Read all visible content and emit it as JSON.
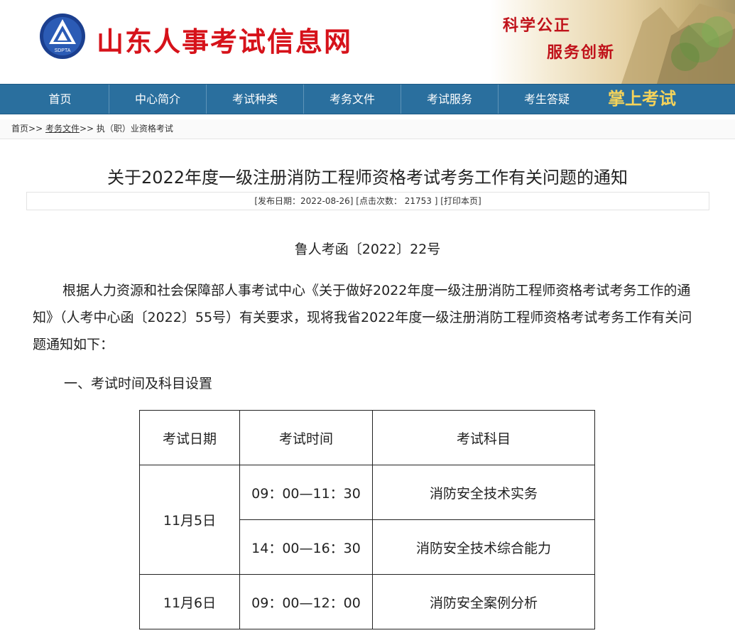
{
  "header": {
    "logo_text": "SDPTA",
    "site_title": "山东人事考试信息网",
    "slogan_line1": "科学公正",
    "slogan_line2": "服务创新"
  },
  "nav": {
    "items": [
      "首页",
      "中心简介",
      "考试种类",
      "考务文件",
      "考试服务",
      "考生答疑"
    ],
    "mobile": "掌上考试"
  },
  "breadcrumb": {
    "home": "首页",
    "sep": ">>",
    "level1": "考务文件",
    "level2": "执（职）业资格考试"
  },
  "article": {
    "title": "关于2022年度一级注册消防工程师资格考试考务工作有关问题的通知",
    "meta": "[发布日期：2022-08-26] [点击次数： 21753 ] [打印本页]",
    "doc_no": "鲁人考函〔2022〕22号",
    "paragraph": "根据人力资源和社会保障部人事考试中心《关于做好2022年度一级注册消防工程师资格考试考务工作的通知》（人考中心函〔2022〕55号）有关要求，现将我省2022年度一级注册消防工程师资格考试考务工作有关问题通知如下：",
    "section1": "一、考试时间及科目设置"
  },
  "schedule": {
    "headers": [
      "考试日期",
      "考试时间",
      "考试科目"
    ],
    "day1": "11月5日",
    "day2": "11月6日",
    "rows": [
      {
        "time": "09：00—11：30",
        "subject": "消防安全技术实务"
      },
      {
        "time": "14：00—16：30",
        "subject": "消防安全技术综合能力"
      },
      {
        "time": "09：00—12：00",
        "subject": "消防安全案例分析"
      }
    ]
  },
  "colors": {
    "nav_bg": "#2a6f9e",
    "title_red": "#d6121a",
    "mobile_gold": "#f5d35a"
  }
}
